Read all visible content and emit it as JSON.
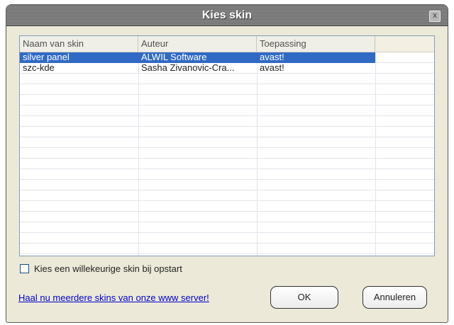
{
  "window": {
    "title": "Kies skin",
    "close_icon": "close-icon"
  },
  "table": {
    "columns": [
      "Naam van skin",
      "Auteur",
      "Toepassing",
      ""
    ],
    "rows": [
      {
        "name": "silver panel",
        "author": "ALWIL Software",
        "app": "avast!",
        "selected": true
      },
      {
        "name": "szc-kde",
        "author": "Sasha Zivanovic-Cra...",
        "app": "avast!",
        "selected": false
      }
    ]
  },
  "options": {
    "random_skin_label": "Kies een willekeurige skin bij opstart",
    "random_skin_checked": false
  },
  "footer": {
    "link_text": "Haal nu meerdere skins van onze www server!",
    "ok_label": "OK",
    "cancel_label": "Annuleren"
  },
  "colors": {
    "selection": "#316ac5",
    "link": "#0000cc"
  }
}
